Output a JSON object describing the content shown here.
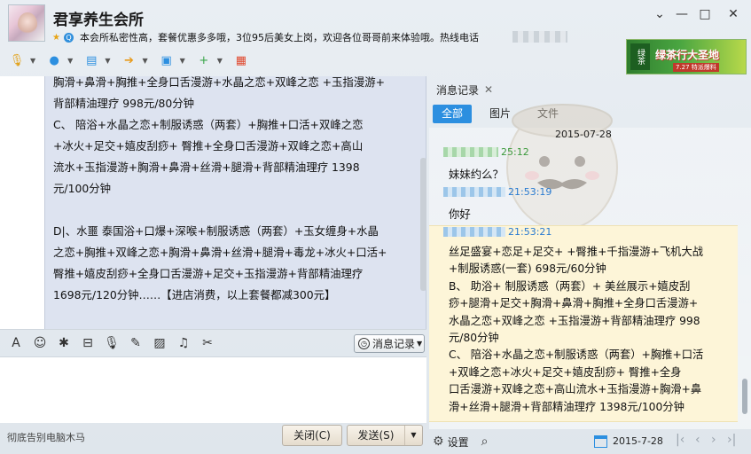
{
  "window": {
    "title": "君享养生会所",
    "notice": "本会所私密性高，套餐优惠多多哦，3位95后美女上岗，欢迎各位哥哥前来体验哦。热线电话",
    "controls": {
      "settings": "⌄",
      "minimize": "—",
      "maximize": "□",
      "close": "✕"
    }
  },
  "toolbar": {
    "items": [
      {
        "name": "voice-call",
        "icon": "🎙",
        "color": "#e2a21b"
      },
      {
        "name": "video-call",
        "icon": "●",
        "color": "#2c8fe0"
      },
      {
        "name": "remote-desktop",
        "icon": "▤",
        "color": "#2c8fe0"
      },
      {
        "name": "send-file",
        "icon": "➔",
        "color": "#e89a1a"
      },
      {
        "name": "screen-share",
        "icon": "▣",
        "color": "#2c8fe0"
      },
      {
        "name": "create-group",
        "icon": "+",
        "color": "#3aa64a"
      },
      {
        "name": "apps",
        "icon": "▦",
        "color": "#e0492f"
      }
    ]
  },
  "ad": {
    "brand": "绿茶",
    "title": "绿茶行大圣地",
    "sub": "7.27 特派爆料"
  },
  "chat": {
    "message_lines": [
      "胸滑+鼻滑+胸推+全身口舌漫游+水晶之恋+双峰之恋 +玉指漫游+",
      "背部精油理疗  998元/80分钟",
      "C、     陪浴+水晶之恋+制服诱惑（两套）+胸推+口活+双峰之恋",
      "+冰火+足交+嬉皮刮痧+      臀推+全身口舌漫游+双峰之恋+高山",
      "流水+玉指漫游+胸滑+鼻滑+丝滑+腿滑+背部精油理疗 1398",
      "元/100分钟",
      "",
      "D|、水噩 泰国浴+口爆+深喉+制服诱惑（两套）+玉女缠身+水晶",
      "之恋+胸推+双峰之恋+胸滑+鼻滑+丝滑+腿滑+毒龙+冰火+口活+",
      "臀推+嬉皮刮痧+全身口舌漫游+足交+玉指漫游+背部精油理疗",
      "1698元/120分钟……【进店消费，以上套餐都减300元】"
    ]
  },
  "input_toolbar": {
    "icons": [
      "A",
      "☺",
      "✱",
      "⊟",
      "🎙",
      "✎",
      "▨",
      "♫",
      "✂"
    ],
    "history_label": "消息记录"
  },
  "bottom": {
    "status": "彻底告别电脑木马",
    "close_label": "关闭(C)",
    "send_label": "发送(S)"
  },
  "history": {
    "tab_label": "消息记录",
    "filters": [
      "全部",
      "图片",
      "文件"
    ],
    "date_header": "2015-07-28",
    "entries": [
      {
        "time": "25:12",
        "text": "妹妹约么？"
      },
      {
        "time": "21:53:19",
        "text": "你好"
      },
      {
        "time": "21:53:21"
      }
    ],
    "highlight_lines": [
      "丝足盛宴+恋足+足交+ +臀推+千指漫游+飞机大战",
      "+制服诱惑(一套) 698元/60分钟",
      "B、   助浴+ 制服诱惑（两套）+ 美丝展示+嬉皮刮",
      "痧+腿滑+足交+胸滑+鼻滑+胸推+全身口舌漫游+",
      "水晶之恋+双峰之恋 +玉指漫游+背部精油理疗  998",
      "元/80分钟",
      "C、 陪浴+水晶之恋+制服诱惑（两套）+胸推+口活",
      "+双峰之恋+冰火+足交+嬉皮刮痧+      臀推+全身",
      "口舌漫游+双峰之恋+高山流水+玉指漫游+胸滑+鼻",
      "滑+丝滑+腿滑+背部精油理疗 1398元/100分钟"
    ],
    "footer": {
      "settings_label": "设置",
      "date": "2015-7-28"
    }
  }
}
